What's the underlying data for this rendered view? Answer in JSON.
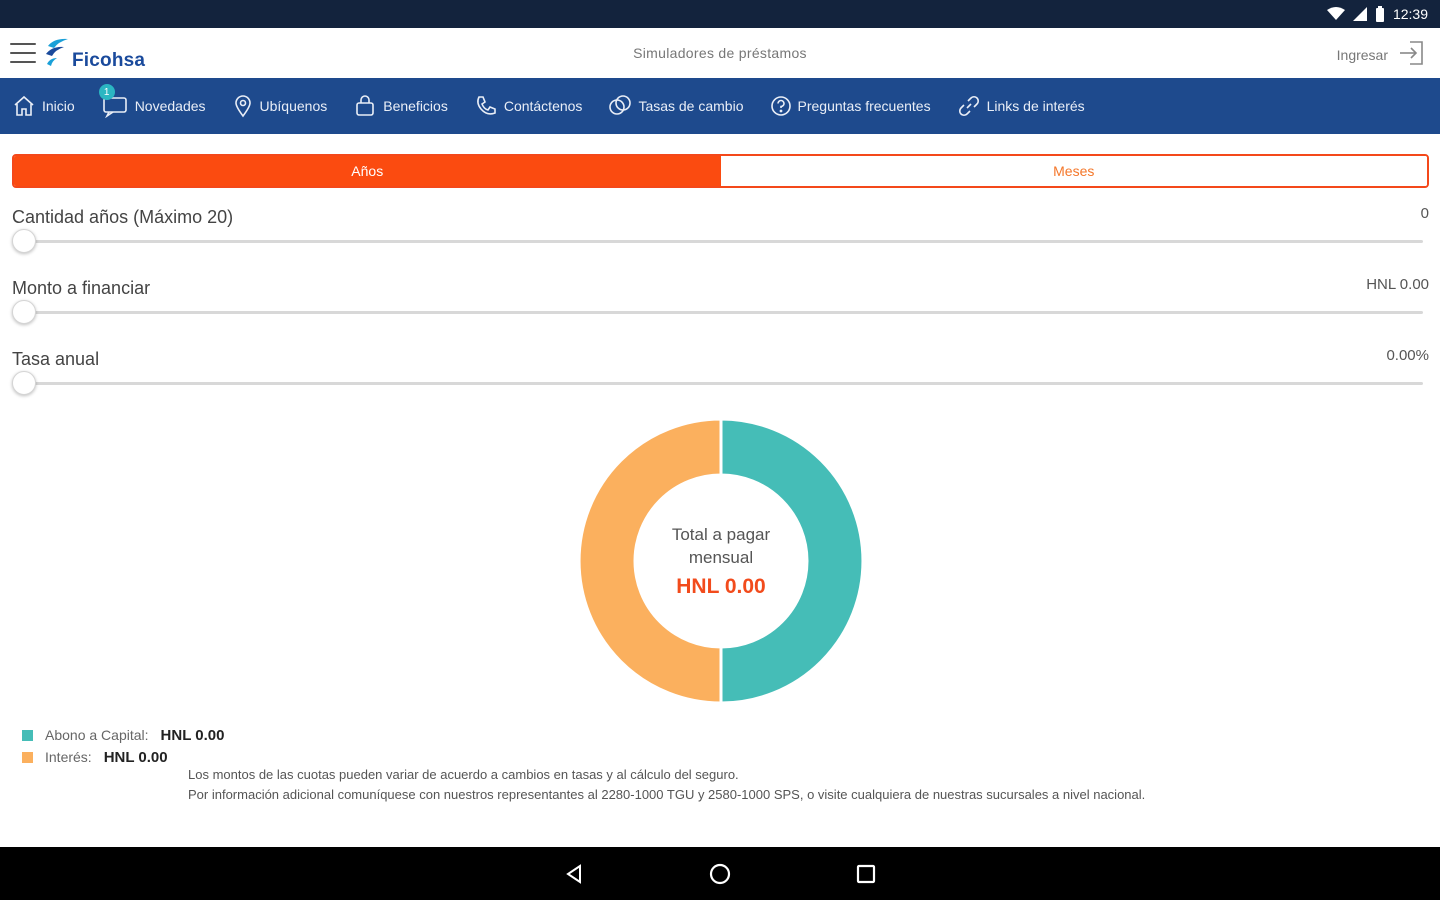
{
  "status_bar": {
    "time": "12:39"
  },
  "header": {
    "brand": "Ficohsa",
    "title": "Simuladores de préstamos",
    "login_label": "Ingresar"
  },
  "nav": {
    "items": [
      {
        "label": "Inicio",
        "icon": "home-icon"
      },
      {
        "label": "Novedades",
        "icon": "chat-icon",
        "badge": "1"
      },
      {
        "label": "Ubíquenos",
        "icon": "location-pin-icon"
      },
      {
        "label": "Beneficios",
        "icon": "shopping-bag-icon"
      },
      {
        "label": "Contáctenos",
        "icon": "phone-icon"
      },
      {
        "label": "Tasas de cambio",
        "icon": "exchange-icon"
      },
      {
        "label": "Preguntas frecuentes",
        "icon": "question-icon"
      },
      {
        "label": "Links de interés",
        "icon": "link-icon"
      }
    ]
  },
  "segment": {
    "options": [
      "Años",
      "Meses"
    ],
    "selected": "Años"
  },
  "sliders": [
    {
      "label": "Cantidad años (Máximo 20)",
      "value": "0",
      "level": 0
    },
    {
      "label": "Monto a financiar",
      "value": "HNL 0.00",
      "level": 0
    },
    {
      "label": "Tasa anual",
      "value": "0.00%",
      "level": 0
    }
  ],
  "donut": {
    "center_label": "Total a pagar mensual",
    "center_value": "HNL 0.00"
  },
  "legend": [
    {
      "label": "Abono a Capital:",
      "value": "HNL 0.00",
      "color": "#45bdb7"
    },
    {
      "label": "Interés:",
      "value": "HNL 0.00",
      "color": "#fbb05e"
    }
  ],
  "notes": [
    "Los montos de las cuotas pueden variar de acuerdo a cambios en tasas y al cálculo del seguro.",
    "Por información adicional comuníquese con nuestros representantes al 2280-1000 TGU y 2580-1000 SPS, o visite cualquiera de nuestras sucursales a nivel nacional."
  ],
  "chart_data": {
    "type": "pie",
    "categories": [
      "Abono a Capital",
      "Interés"
    ],
    "values": [
      50,
      50
    ],
    "colors": [
      "#45bdb7",
      "#fbb05e"
    ],
    "title": "",
    "xlabel": "",
    "ylabel": ""
  }
}
